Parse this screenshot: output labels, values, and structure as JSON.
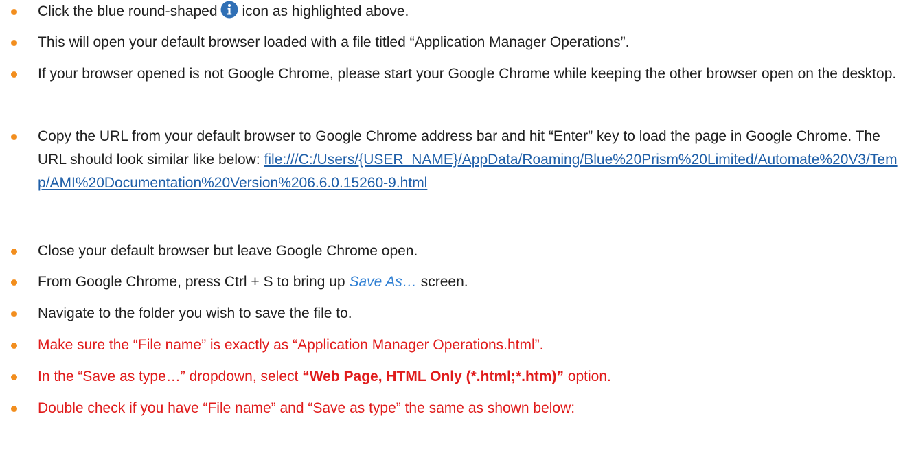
{
  "colors": {
    "bullet": "#f28e1e",
    "warning_text": "#e01b1b",
    "link": "#1f5fa8",
    "info_icon": "#2f6fb5"
  },
  "steps": [
    {
      "before_icon": "Click the blue round-shaped",
      "icon": "info-icon",
      "after_icon": "icon as highlighted above."
    },
    {
      "text": "This will open your default browser loaded with a file titled “Application Manager Operations”."
    },
    {
      "text": "If your browser opened is not Google Chrome, please start your Google Chrome while keeping the other browser open on the desktop."
    },
    {
      "text": "Copy the URL from your default browser to Google Chrome address bar and hit “Enter” key to load the page in Google Chrome. The URL should look similar like below:",
      "link": "file:///C:/Users/{USER_NAME}/AppData/Roaming/Blue%20Prism%20Limited/Automate%20V3/Temp/AMI%20Documentation%20Version%206.6.0.15260-9.html"
    },
    {
      "text": "Close your default browser but leave Google Chrome open."
    },
    {
      "before": "From Google Chrome, press Ctrl + S to bring up",
      "emphasis": "Save As…",
      "after": "screen."
    },
    {
      "text": "Navigate to the folder you wish to save the file to."
    },
    {
      "text": "Make sure the “File name” is exactly as “Application Manager Operations.html”."
    },
    {
      "before": "In the “Save as type…” dropdown, select",
      "bold": "“Web Page, HTML Only (*.html;*.htm)”",
      "after": "option."
    },
    {
      "text": "Double check if you have “File name” and “Save as type” the same as shown below:"
    }
  ]
}
